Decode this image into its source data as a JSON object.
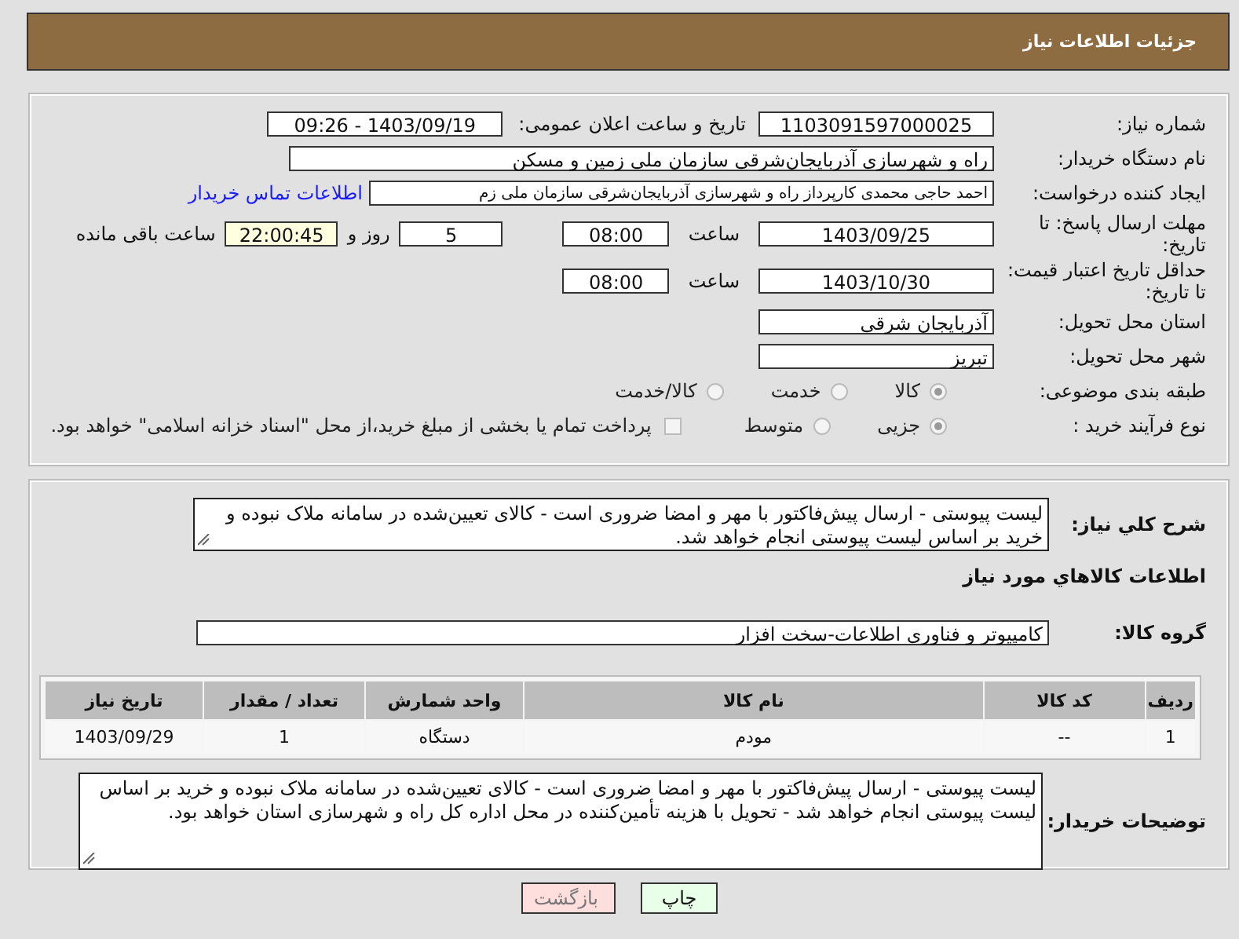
{
  "header": {
    "title": "جزئیات اطلاعات نیاز"
  },
  "need_number": {
    "label": "شماره نیاز:",
    "value": "1103091597000025"
  },
  "announce": {
    "label": "تاريخ و ساعت اعلان عمومی:",
    "value": "1403/09/19 - 09:26"
  },
  "buyer_org": {
    "label": "نام دستگاه خریدار:",
    "value": "راه و شهرسازی آذربایجان‌شرقی   سازمان ملی زمین و مسکن"
  },
  "requester": {
    "label": "ایجاد کننده درخواست:",
    "value": "احمد حاجی محمدی کارپرداز راه و شهرسازی آذربایجان‌شرقی   سازمان ملی زم",
    "link": "اطلاعات تماس خریدار"
  },
  "reply_deadline": {
    "label": "مهلت ارسال پاسخ: تا تاریخ:",
    "date": "1403/09/25",
    "time_label": "ساعت",
    "time": "08:00",
    "days": "5",
    "days_label": "روز و",
    "remaining": "22:00:45",
    "remaining_label": "ساعت باقی مانده"
  },
  "price_validity": {
    "label": "حداقل تاریخ اعتبار قیمت: تا تاریخ:",
    "date": "1403/10/30",
    "time_label": "ساعت",
    "time": "08:00"
  },
  "province": {
    "label": "استان محل تحویل:",
    "value": "آذربایجان شرقی"
  },
  "city": {
    "label": "شهر محل تحویل:",
    "value": "تبریز"
  },
  "category": {
    "label": "طبقه بندی موضوعی:",
    "options": [
      {
        "label": "کالا",
        "selected": true
      },
      {
        "label": "خدمت",
        "selected": false
      },
      {
        "label": "کالا/خدمت",
        "selected": false
      }
    ]
  },
  "purchase_type": {
    "label": "نوع فرآیند خرید :",
    "options": [
      {
        "label": "جزیی",
        "selected": true
      },
      {
        "label": "متوسط",
        "selected": false
      }
    ],
    "treasury": {
      "checked": false,
      "text": "پرداخت تمام یا بخشی از مبلغ خرید،از محل \"اسناد خزانه اسلامی\" خواهد بود."
    }
  },
  "description": {
    "label": "شرح کلي نياز:",
    "value": "لیست پیوستی - ارسال پیش‌فاکتور با مهر و امضا ضروری است - کالای تعیین‌شده در سامانه ملاک نبوده و خرید بر اساس لیست پیوستی انجام خواهد شد."
  },
  "goods_title": "اطلاعات کالاهاي مورد نياز",
  "goods_group": {
    "label": "گروه کالا:",
    "value": "کامپیوتر و فناوری اطلاعات-سخت افزار"
  },
  "table": {
    "columns": [
      "ردیف",
      "کد کالا",
      "نام کالا",
      "واحد شمارش",
      "تعداد / مقدار",
      "تاریخ نیاز"
    ],
    "rows": [
      [
        "1",
        "--",
        "مودم",
        "دستگاه",
        "1",
        "1403/09/29"
      ]
    ]
  },
  "buyer_notes": {
    "label": "توضیحات خریدار:",
    "value": "لیست پیوستی - ارسال پیش‌فاکتور با مهر و امضا ضروری است - کالای تعیین‌شده در سامانه ملاک نبوده و خرید بر اساس لیست پیوستی انجام خواهد شد - تحویل با هزینه تأمین‌کننده در محل اداره کل راه و شهرسازی استان خواهد بود."
  },
  "buttons": [
    {
      "label": "چاپ",
      "kind": "print"
    },
    {
      "label": "بازگشت",
      "kind": "back"
    }
  ]
}
